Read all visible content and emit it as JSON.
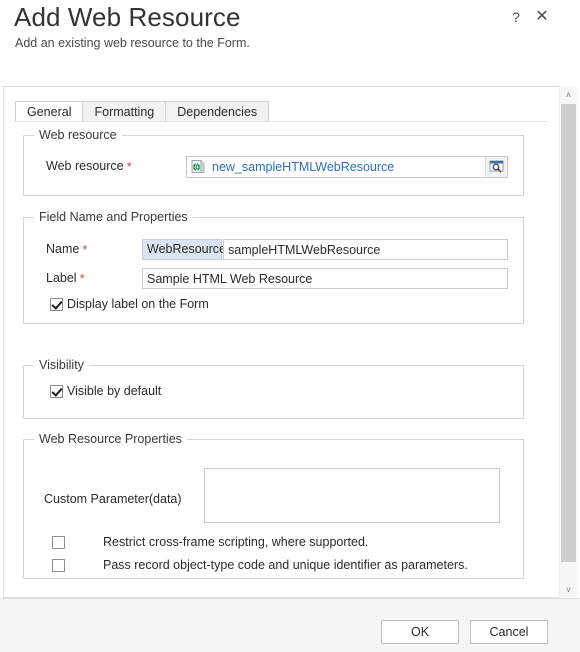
{
  "dialog": {
    "title": "Add Web Resource",
    "subtitle": "Add an existing web resource to the Form.",
    "help_label": "?",
    "close_label": "✕"
  },
  "tabs": [
    {
      "label": "General",
      "active": true
    },
    {
      "label": "Formatting",
      "active": false
    },
    {
      "label": "Dependencies",
      "active": false
    }
  ],
  "groups": {
    "web_resource": {
      "legend": "Web resource",
      "field_label": "Web resource",
      "required": true,
      "value": "new_sampleHTMLWebResource",
      "value_color": "#2f6fb5",
      "lookup_button_title": "Browse",
      "record_icon": "web-resource-icon"
    },
    "field_name": {
      "legend": "Field Name and Properties",
      "name_label": "Name",
      "name_required": true,
      "name_prefix": "WebResource_",
      "name_value": "sampleHTMLWebResource",
      "name_placeholder": "",
      "label_label": "Label",
      "label_required": true,
      "label_value": "Sample HTML Web Resource",
      "label_placeholder": "",
      "display_label_checkbox": {
        "label": "Display label on the Form",
        "checked": true
      }
    },
    "visibility": {
      "legend": "Visibility",
      "visible_checkbox": {
        "label": "Visible by default",
        "checked": true
      }
    },
    "web_resource_properties": {
      "legend": "Web Resource Properties",
      "custom_parameter_label": "Custom Parameter(data)",
      "custom_parameter_value": "",
      "custom_parameter_placeholder": "",
      "restrict_checkbox": {
        "label": "Restrict cross-frame scripting, where supported.",
        "checked": false
      },
      "pass_record_checkbox": {
        "label": "Pass record object-type code and unique identifier as parameters.",
        "checked": false
      }
    }
  },
  "scrollbar": {
    "up_arrow": "˄",
    "down_arrow": "˅"
  },
  "footer": {
    "ok_label": "OK",
    "cancel_label": "Cancel"
  },
  "colors": {
    "accent_link": "#2f6fb5",
    "required_star": "#d44a3a",
    "prefix_background": "#dbe5f1",
    "footer_background": "#f5f5f5"
  }
}
